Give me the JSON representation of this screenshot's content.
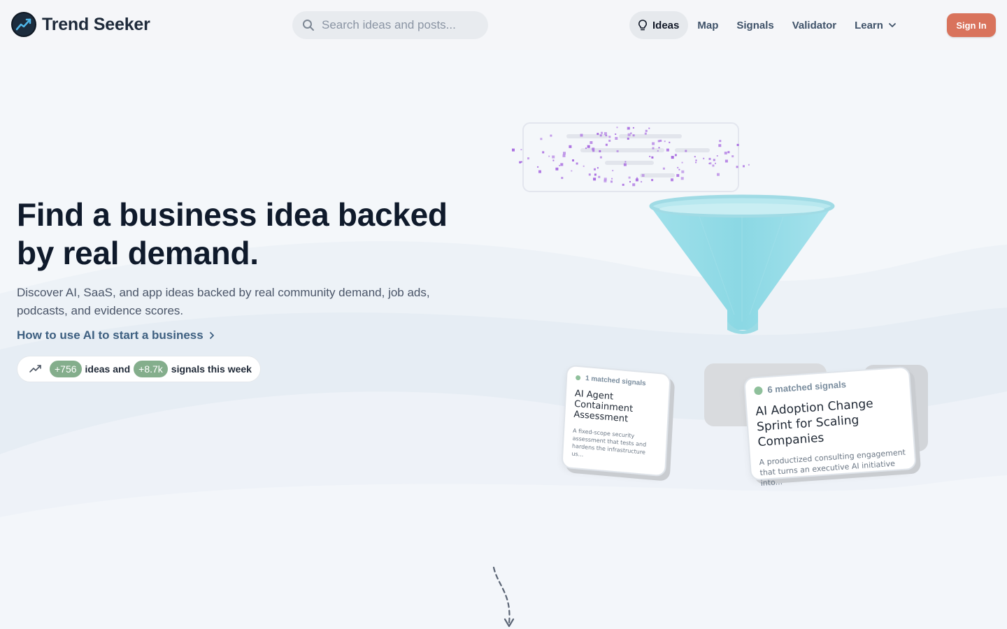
{
  "app": {
    "name": "Trend Seeker"
  },
  "search": {
    "placeholder": "Search ideas and posts..."
  },
  "nav": {
    "items": [
      {
        "label": "Ideas",
        "active": true
      },
      {
        "label": "Map"
      },
      {
        "label": "Signals"
      },
      {
        "label": "Validator"
      },
      {
        "label": "Learn",
        "has_dropdown": true
      }
    ],
    "signin_label": "Sign In"
  },
  "hero": {
    "title": "Find a business idea backed by real demand.",
    "subtitle": "Discover AI, SaaS, and app ideas backed by real community demand, job ads, podcasts, and evidence scores.",
    "link_label": "How to use AI to start a business"
  },
  "stats": {
    "ideas_count": "+756",
    "ideas_label": "ideas and",
    "signals_count": "+8.7k",
    "signals_label": "signals this week"
  },
  "illustration": {
    "card_small": {
      "tag": "1 matched signals",
      "title": "AI Agent Containment Assessment",
      "description": "A fixed-scope security assessment that tests and hardens the infrastructure us..."
    },
    "card_large": {
      "tag": "6 matched signals",
      "title": "AI Adoption Change Sprint for Scaling Companies",
      "description": "A productized consulting engagement that turns an executive AI initiative into..."
    }
  },
  "colors": {
    "accent_signin": "#d9735c",
    "pill_green": "#84ae8c",
    "funnel": "#8fdbe6",
    "particles": "#a86be0",
    "link": "#3d5f80"
  },
  "icons": [
    "logo-trend-icon",
    "search-icon",
    "bulb-icon",
    "chevron-down-icon",
    "chevron-right-icon",
    "trend-up-icon"
  ]
}
